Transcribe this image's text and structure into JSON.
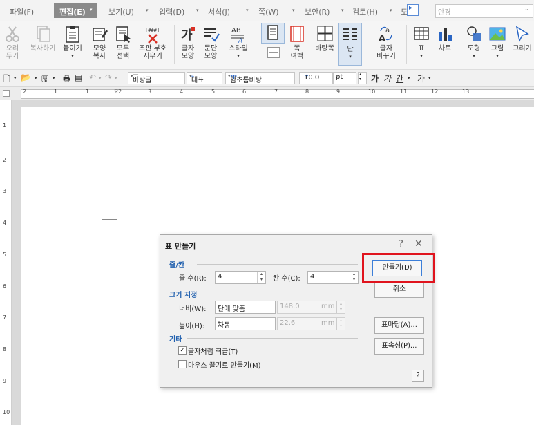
{
  "menu": {
    "file": "파일(F)",
    "edit": "편집(E)",
    "view": "보기(U)",
    "input": "입력(D)",
    "format": "서식(J)",
    "page": "쪽(W)",
    "security": "보안(R)",
    "review": "검토(H)",
    "more": "도",
    "search_placeholder": "안경"
  },
  "ribbon": {
    "cut": "오려\n두기",
    "copy": "복사하기",
    "paste": "붙이기",
    "format_copy": "모양\n복사",
    "select_all": "모두\n선택",
    "clear_marks": "조판 부호\n지우기",
    "char_shape": "글자\n모양",
    "para_shape": "문단\n모양",
    "style": "스타일",
    "page_margin": "쪽\n여백",
    "background": "바탕쪽",
    "column": "단",
    "char_change": "글자\n바꾸기",
    "table": "표",
    "chart": "차트",
    "shape": "도형",
    "picture": "그림",
    "draw": "그리기"
  },
  "toolbar": {
    "style_combo": "바탕글",
    "lang_combo": "대표",
    "font_combo": "함초롬바탕",
    "size_combo": "10.0",
    "unit_combo": "pt"
  },
  "ruler": {
    "h": [
      "2",
      "1",
      "1",
      "2",
      "3",
      "4",
      "5",
      "6",
      "7",
      "8",
      "9",
      "10",
      "11",
      "12",
      "13"
    ],
    "v": [
      "1",
      "2",
      "3",
      "4",
      "5",
      "6",
      "7",
      "8",
      "9",
      "10"
    ]
  },
  "dialog": {
    "title": "표 만들기",
    "help": "?",
    "close": "✕",
    "section_rowcol": "줄/칸",
    "rows_label": "줄 수(R):",
    "rows_value": "4",
    "cols_label": "칸 수(C):",
    "cols_value": "4",
    "section_size": "크기 지정",
    "width_label": "너비(W):",
    "width_option": "단에 맞춤",
    "width_value": "148.0",
    "width_unit": "mm",
    "height_label": "높이(H):",
    "height_option": "자동",
    "height_value": "22.6",
    "height_unit": "mm",
    "section_etc": "기타",
    "treat_as_char": "글자처럼 취급(T)",
    "treat_as_char_checked": true,
    "mouse_drag": "마우스 끌기로 만들기(M)",
    "mouse_drag_checked": false,
    "create_button": "만들기(D)",
    "cancel_button": "취소",
    "cell_fill_button": "표마당(A)...",
    "properties_button": "표속성(P)...",
    "help_button": "?"
  },
  "colors": {
    "section_title": "#1f5fae",
    "highlight": "#e0141e",
    "default_button_border": "#3c7fd9"
  }
}
